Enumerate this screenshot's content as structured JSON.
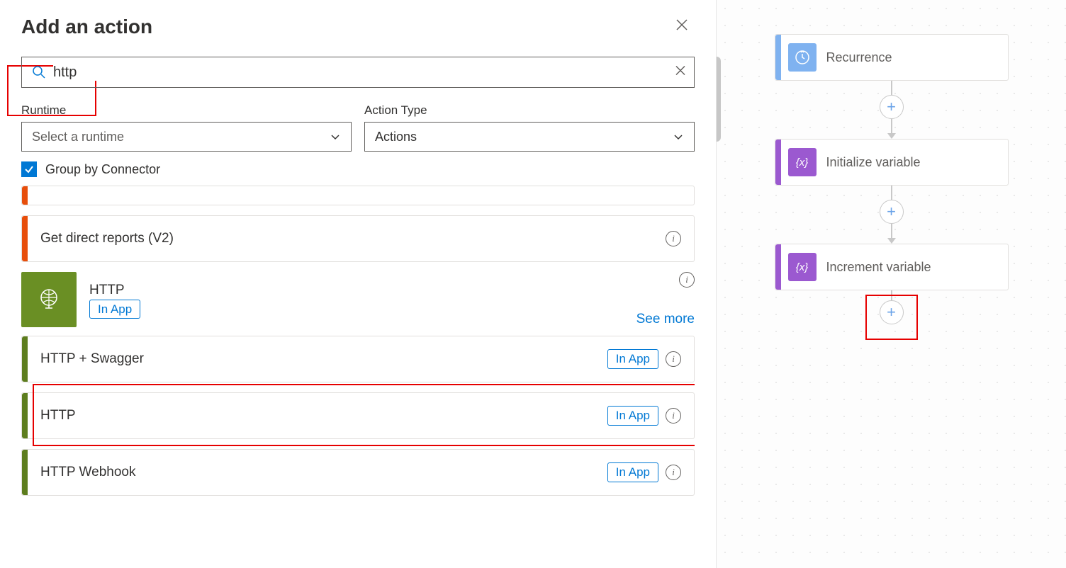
{
  "panel": {
    "title": "Add an action",
    "search_value": "http",
    "runtime_label": "Runtime",
    "runtime_placeholder": "Select a runtime",
    "action_type_label": "Action Type",
    "action_type_value": "Actions",
    "group_by_label": "Group by Connector"
  },
  "results": {
    "prior_action": "Get direct reports (V2)",
    "connector": {
      "name": "HTTP",
      "badge": "In App",
      "see_more": "See more"
    },
    "actions": [
      {
        "label": "HTTP + Swagger",
        "badge": "In App"
      },
      {
        "label": "HTTP",
        "badge": "In App"
      },
      {
        "label": "HTTP Webhook",
        "badge": "In App"
      }
    ]
  },
  "flow": {
    "nodes": [
      {
        "label": "Recurrence",
        "kind": "recur"
      },
      {
        "label": "Initialize variable",
        "kind": "var"
      },
      {
        "label": "Increment variable",
        "kind": "var"
      }
    ]
  }
}
